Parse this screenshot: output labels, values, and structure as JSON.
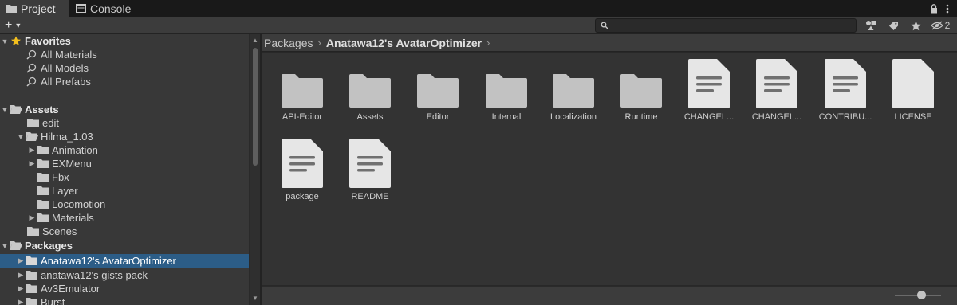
{
  "tabs": [
    {
      "label": "Project",
      "icon": "folder-icon"
    },
    {
      "label": "Console",
      "icon": "console-icon"
    }
  ],
  "toolbar": {
    "add_label": "+",
    "search_placeholder": "",
    "hidden_count": "2"
  },
  "tree": {
    "favorites": {
      "label": "Favorites",
      "items": [
        "All Materials",
        "All Models",
        "All Prefabs"
      ]
    },
    "assets": "Assets",
    "edit": "edit",
    "hilma": "Hilma_1.03",
    "hilma_children": [
      "Animation",
      "EXMenu",
      "Fbx",
      "Layer",
      "Locomotion",
      "Materials"
    ],
    "scenes": "Scenes",
    "packages": "Packages",
    "package_items": [
      "Anatawa12's AvatarOptimizer",
      "anatawa12's gists pack",
      "Av3Emulator",
      "Burst"
    ]
  },
  "breadcrumb": {
    "root": "Packages",
    "current": "Anatawa12's AvatarOptimizer"
  },
  "assets": [
    {
      "label": "API-Editor",
      "kind": "folder"
    },
    {
      "label": "Assets",
      "kind": "folder"
    },
    {
      "label": "Editor",
      "kind": "folder"
    },
    {
      "label": "Internal",
      "kind": "folder"
    },
    {
      "label": "Localization",
      "kind": "folder"
    },
    {
      "label": "Runtime",
      "kind": "folder"
    },
    {
      "label": "CHANGEL...",
      "kind": "text"
    },
    {
      "label": "CHANGEL...",
      "kind": "text"
    },
    {
      "label": "CONTRIBU...",
      "kind": "text"
    },
    {
      "label": "LICENSE",
      "kind": "blank"
    },
    {
      "label": "package",
      "kind": "text"
    },
    {
      "label": "README",
      "kind": "text"
    }
  ],
  "zoom_slider": 0.5,
  "colors": {
    "selection": "#2c5d87",
    "favorite_star": "#f4c01e"
  }
}
